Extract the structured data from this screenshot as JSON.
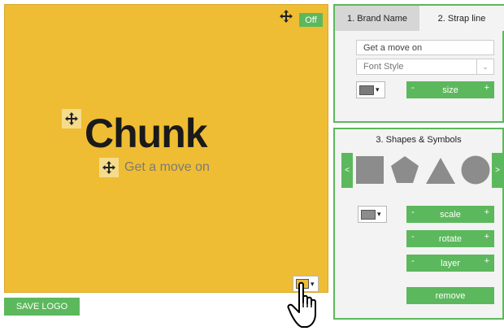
{
  "canvas": {
    "background": "#efbd33",
    "brand_name": "Chunk",
    "strap_line": "Get a move on",
    "toggle_label": "Off",
    "color_picker_arrow": "▾"
  },
  "actions": {
    "save_label": "SAVE LOGO"
  },
  "text_panel": {
    "tabs": [
      {
        "label": "1. Brand Name",
        "active": false
      },
      {
        "label": "2. Strap line",
        "active": true
      }
    ],
    "strap_input_value": "Get a move on",
    "font_style_placeholder": "Font Style",
    "color_arrow": "▾",
    "size_control": {
      "minus": "-",
      "label": "size",
      "plus": "+"
    }
  },
  "shapes_panel": {
    "title": "3. Shapes & Symbols",
    "prev": "<",
    "next": ">",
    "shapes": [
      "square-icon",
      "pentagon-icon",
      "triangle-icon",
      "circle-icon"
    ],
    "color_arrow": "▾",
    "controls": [
      {
        "minus": "-",
        "label": "scale",
        "plus": "+"
      },
      {
        "minus": "-",
        "label": "rotate",
        "plus": "+"
      },
      {
        "minus": "-",
        "label": "layer",
        "plus": "+"
      }
    ],
    "remove_label": "remove"
  },
  "colors": {
    "accent": "#5cb85c",
    "canvas": "#efbd33",
    "shape": "#8c8c8c"
  }
}
